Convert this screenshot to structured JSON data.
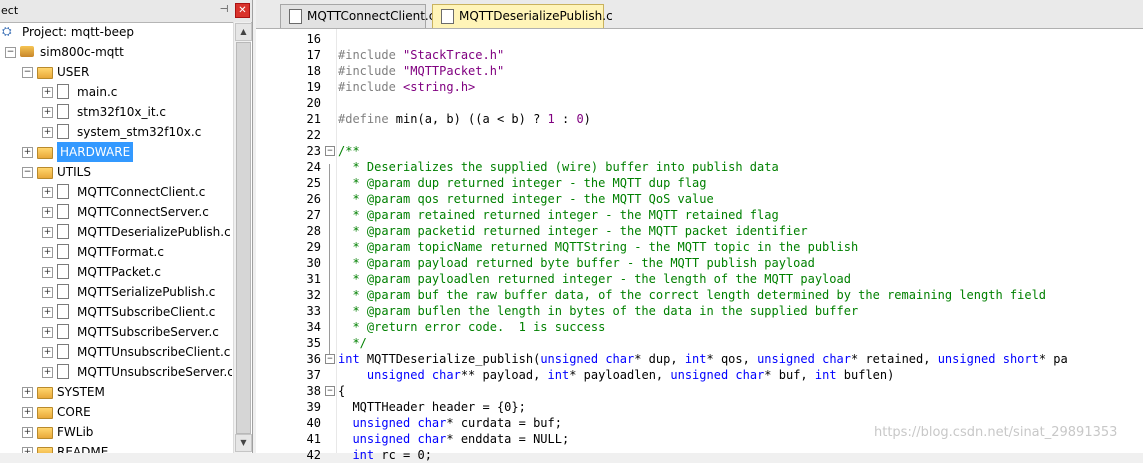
{
  "project_panel": {
    "title": "ect",
    "pin_icon": "pin-icon",
    "close_icon": "close-icon",
    "tree": [
      {
        "label": "Project: mqtt-beep",
        "indent": 0,
        "icon": "project-icon",
        "expander": ""
      },
      {
        "label": "sim800c-mqtt",
        "indent": 1,
        "icon": "target-icon",
        "expander": "−"
      },
      {
        "label": "USER",
        "indent": 2,
        "icon": "folder-icon",
        "expander": "−"
      },
      {
        "label": "main.c",
        "indent": 3,
        "icon": "file-icon",
        "expander": "+"
      },
      {
        "label": "stm32f10x_it.c",
        "indent": 3,
        "icon": "file-icon",
        "expander": "+"
      },
      {
        "label": "system_stm32f10x.c",
        "indent": 3,
        "icon": "file-icon",
        "expander": "+"
      },
      {
        "label": "HARDWARE",
        "indent": 2,
        "icon": "folder-icon",
        "expander": "+",
        "selected": true
      },
      {
        "label": "UTILS",
        "indent": 2,
        "icon": "folder-icon",
        "expander": "−"
      },
      {
        "label": "MQTTConnectClient.c",
        "indent": 3,
        "icon": "file-icon",
        "expander": "+"
      },
      {
        "label": "MQTTConnectServer.c",
        "indent": 3,
        "icon": "file-icon",
        "expander": "+"
      },
      {
        "label": "MQTTDeserializePublish.c",
        "indent": 3,
        "icon": "file-icon",
        "expander": "+"
      },
      {
        "label": "MQTTFormat.c",
        "indent": 3,
        "icon": "file-icon",
        "expander": "+"
      },
      {
        "label": "MQTTPacket.c",
        "indent": 3,
        "icon": "file-icon",
        "expander": "+"
      },
      {
        "label": "MQTTSerializePublish.c",
        "indent": 3,
        "icon": "file-icon",
        "expander": "+"
      },
      {
        "label": "MQTTSubscribeClient.c",
        "indent": 3,
        "icon": "file-icon",
        "expander": "+"
      },
      {
        "label": "MQTTSubscribeServer.c",
        "indent": 3,
        "icon": "file-icon",
        "expander": "+"
      },
      {
        "label": "MQTTUnsubscribeClient.c",
        "indent": 3,
        "icon": "file-icon",
        "expander": "+"
      },
      {
        "label": "MQTTUnsubscribeServer.c",
        "indent": 3,
        "icon": "file-icon",
        "expander": "+"
      },
      {
        "label": "SYSTEM",
        "indent": 2,
        "icon": "folder-icon",
        "expander": "+"
      },
      {
        "label": "CORE",
        "indent": 2,
        "icon": "folder-icon",
        "expander": "+"
      },
      {
        "label": "FWLib",
        "indent": 2,
        "icon": "folder-icon",
        "expander": "+"
      },
      {
        "label": "README",
        "indent": 2,
        "icon": "folder-icon",
        "expander": "+"
      }
    ]
  },
  "editor": {
    "tabs": [
      {
        "label": "MQTTConnectClient.c",
        "active": false
      },
      {
        "label": "MQTTDeserializePublish.c",
        "active": true
      }
    ],
    "lines": [
      {
        "n": "16",
        "fold": "",
        "parts": []
      },
      {
        "n": "17",
        "fold": "",
        "parts": [
          [
            "pp",
            "#include "
          ],
          [
            "str",
            "\"StackTrace.h\""
          ]
        ]
      },
      {
        "n": "18",
        "fold": "",
        "parts": [
          [
            "pp",
            "#include "
          ],
          [
            "str",
            "\"MQTTPacket.h\""
          ]
        ]
      },
      {
        "n": "19",
        "fold": "",
        "parts": [
          [
            "pp",
            "#include "
          ],
          [
            "str",
            "<string.h>"
          ]
        ]
      },
      {
        "n": "20",
        "fold": "",
        "parts": []
      },
      {
        "n": "21",
        "fold": "",
        "parts": [
          [
            "pp",
            "#define "
          ],
          [
            "nm",
            "min(a, b) ((a < b) ? "
          ],
          [
            "str",
            "1"
          ],
          [
            "nm",
            " : "
          ],
          [
            "str",
            "0"
          ],
          [
            "nm",
            ")"
          ]
        ]
      },
      {
        "n": "22",
        "fold": "",
        "parts": []
      },
      {
        "n": "23",
        "fold": "−",
        "parts": [
          [
            "cm",
            "/**"
          ]
        ]
      },
      {
        "n": "24",
        "fold": "",
        "parts": [
          [
            "cm",
            "  * Deserializes the supplied (wire) buffer into publish data"
          ]
        ]
      },
      {
        "n": "25",
        "fold": "",
        "parts": [
          [
            "cm",
            "  * @param dup returned integer - the MQTT dup flag"
          ]
        ]
      },
      {
        "n": "26",
        "fold": "",
        "parts": [
          [
            "cm",
            "  * @param qos returned integer - the MQTT QoS value"
          ]
        ]
      },
      {
        "n": "27",
        "fold": "",
        "parts": [
          [
            "cm",
            "  * @param retained returned integer - the MQTT retained flag"
          ]
        ]
      },
      {
        "n": "28",
        "fold": "",
        "parts": [
          [
            "cm",
            "  * @param packetid returned integer - the MQTT packet identifier"
          ]
        ]
      },
      {
        "n": "29",
        "fold": "",
        "parts": [
          [
            "cm",
            "  * @param topicName returned MQTTString - the MQTT topic in the publish"
          ]
        ]
      },
      {
        "n": "30",
        "fold": "",
        "parts": [
          [
            "cm",
            "  * @param payload returned byte buffer - the MQTT publish payload"
          ]
        ]
      },
      {
        "n": "31",
        "fold": "",
        "parts": [
          [
            "cm",
            "  * @param payloadlen returned integer - the length of the MQTT payload"
          ]
        ]
      },
      {
        "n": "32",
        "fold": "",
        "parts": [
          [
            "cm",
            "  * @param buf the raw buffer data, of the correct length determined by the remaining length field"
          ]
        ]
      },
      {
        "n": "33",
        "fold": "",
        "parts": [
          [
            "cm",
            "  * @param buflen the length in bytes of the data in the supplied buffer"
          ]
        ]
      },
      {
        "n": "34",
        "fold": "",
        "parts": [
          [
            "cm",
            "  * @return error code.  1 is success"
          ]
        ]
      },
      {
        "n": "35",
        "fold": "",
        "parts": [
          [
            "cm",
            "  */"
          ]
        ]
      },
      {
        "n": "36",
        "fold": "−",
        "parts": [
          [
            "kw",
            "int"
          ],
          [
            "nm",
            " MQTTDeserialize_publish("
          ],
          [
            "kw",
            "unsigned char"
          ],
          [
            "nm",
            "* dup, "
          ],
          [
            "kw",
            "int"
          ],
          [
            "nm",
            "* qos, "
          ],
          [
            "kw",
            "unsigned char"
          ],
          [
            "nm",
            "* retained, "
          ],
          [
            "kw",
            "unsigned short"
          ],
          [
            "nm",
            "* pa"
          ]
        ]
      },
      {
        "n": "37",
        "fold": "",
        "parts": [
          [
            "nm",
            "    "
          ],
          [
            "kw",
            "unsigned char"
          ],
          [
            "nm",
            "** payload, "
          ],
          [
            "kw",
            "int"
          ],
          [
            "nm",
            "* payloadlen, "
          ],
          [
            "kw",
            "unsigned char"
          ],
          [
            "nm",
            "* buf, "
          ],
          [
            "kw",
            "int"
          ],
          [
            "nm",
            " buflen)"
          ]
        ]
      },
      {
        "n": "38",
        "fold": "−",
        "parts": [
          [
            "nm",
            "{"
          ]
        ]
      },
      {
        "n": "39",
        "fold": "",
        "parts": [
          [
            "nm",
            "  MQTTHeader header = {0};"
          ]
        ]
      },
      {
        "n": "40",
        "fold": "",
        "parts": [
          [
            "nm",
            "  "
          ],
          [
            "kw",
            "unsigned char"
          ],
          [
            "nm",
            "* curdata = buf;"
          ]
        ]
      },
      {
        "n": "41",
        "fold": "",
        "parts": [
          [
            "nm",
            "  "
          ],
          [
            "kw",
            "unsigned char"
          ],
          [
            "nm",
            "* enddata = NULL;"
          ]
        ]
      },
      {
        "n": "42",
        "fold": "",
        "parts": [
          [
            "nm",
            "  "
          ],
          [
            "kw",
            "int"
          ],
          [
            "nm",
            " rc = 0;"
          ]
        ]
      }
    ]
  },
  "watermark": "https://blog.csdn.net/sinat_29891353"
}
